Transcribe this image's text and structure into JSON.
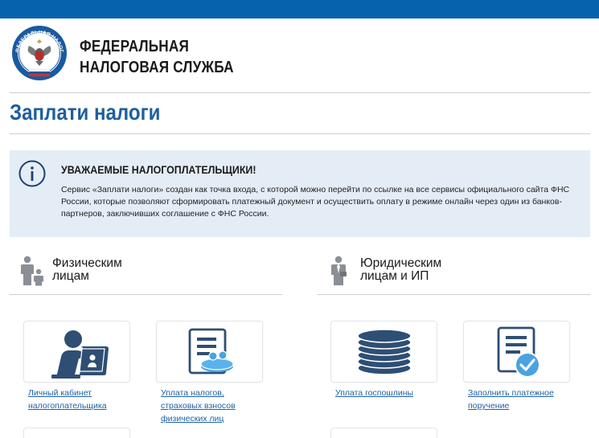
{
  "header": {
    "org_line1": "ФЕДЕРАЛЬНАЯ",
    "org_line2": "НАЛОГОВАЯ СЛУЖБА",
    "logo_text": "ФЕДЕРАЛЬНАЯ НАЛОГОВАЯ СЛУЖБА",
    "brand_color": "#0762ad"
  },
  "page": {
    "title": "Заплати налоги"
  },
  "notice": {
    "icon": "info-icon",
    "heading": "УВАЖАЕМЫЕ НАЛОГОПЛАТЕЛЬЩИКИ!",
    "body": "Сервис «Заплати налоги» создан как точка входа, с которой можно перейти по ссылке на все сервисы официального сайта ФНС России, которые позволяют сформировать платежный документ и осуществить оплату в режиме онлайн через один из банков-партнеров, заключивших соглашение с ФНС России."
  },
  "sections": {
    "individuals": {
      "icon": "family-icon",
      "title_line1": "Физическим",
      "title_line2": "лицам",
      "cards": [
        {
          "icon": "person-computer-icon",
          "label_lines": [
            "Личный кабинет",
            "налогоплательщика"
          ]
        },
        {
          "icon": "document-coins-icon",
          "label_lines": [
            "Уплата налогов,",
            "страховых взносов",
            "физических лиц"
          ]
        }
      ]
    },
    "legal": {
      "icon": "businessman-icon",
      "title_line1": "Юридическим",
      "title_line2": "лицам и ИП",
      "cards": [
        {
          "icon": "coin-stack-icon",
          "label_lines": [
            "Уплата госпошлины"
          ]
        },
        {
          "icon": "document-check-icon",
          "label_lines": [
            "Заполнить платежное",
            "поручение"
          ]
        }
      ]
    }
  },
  "colors": {
    "title": "#1f5f9d",
    "link": "#1d62a6",
    "icon_dark": "#2e4e74",
    "icon_light": "#4aa3e0",
    "notice_bg": "#e4edf6",
    "section_icon": "#8a8f96"
  }
}
